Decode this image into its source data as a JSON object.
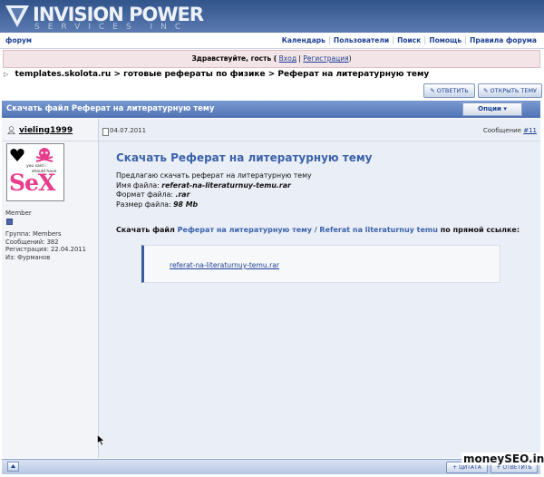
{
  "header": {
    "logo_main": "INVISION POWER",
    "logo_sub": "SERVICES INC"
  },
  "nav": {
    "forum_label": "форум",
    "links": [
      "Календарь",
      "Пользователи",
      "Поиск",
      "Помощь",
      "Правила форума"
    ]
  },
  "greeting": {
    "text": "Здравствуйте, гость (",
    "login": "Вход",
    "sep": "|",
    "register": "Регистрация",
    "close": ")"
  },
  "breadcrumb": {
    "items": [
      "templates.skolota.ru",
      "готовые рефераты по физике",
      "Реферат на литературную тему"
    ],
    "separator": ">"
  },
  "topic_buttons": {
    "reply": "ОТВЕТИТЬ",
    "new_topic": "ОТКРЫТЬ ТЕМУ"
  },
  "topic": {
    "title": "Скачать файл Реферат на литературную тему",
    "options": "Опции ▾"
  },
  "post": {
    "author": "vieling1999",
    "avatar_text": "SeX",
    "avatar_caption_1": "you said i",
    "avatar_caption_2": "should have",
    "group_label": "Member",
    "stats": [
      "Группа: Members",
      "Сообщений: 382",
      "Регистрация: 22.04.2011",
      "Из: Фурманов"
    ],
    "date": "04.07.2011",
    "message_label": "Сообщение",
    "message_num": "#11",
    "heading": "Скачать Реферат на литературную тему",
    "intro": "Предлагаю скачать реферат на литературную тему",
    "file_name_label": "Имя файла:",
    "file_name": "referat-na-literaturnuy-temu.rar",
    "format_label": "Формат файла:",
    "format": ".rar",
    "size_label": "Размер файла:",
    "size": "98 Mb",
    "dl_prefix": "Скачать файл",
    "dl_link": "Реферат на литературную тему / Referat na literaturnuy temu",
    "dl_suffix": "по прямой ссылке:",
    "direct_link": "referat-na-literaturnuy-temu.rar"
  },
  "footer": {
    "quote": "ЦИТАТА",
    "reply": "ОТВЕТИТЬ",
    "watermark": "moneySEO.info"
  }
}
